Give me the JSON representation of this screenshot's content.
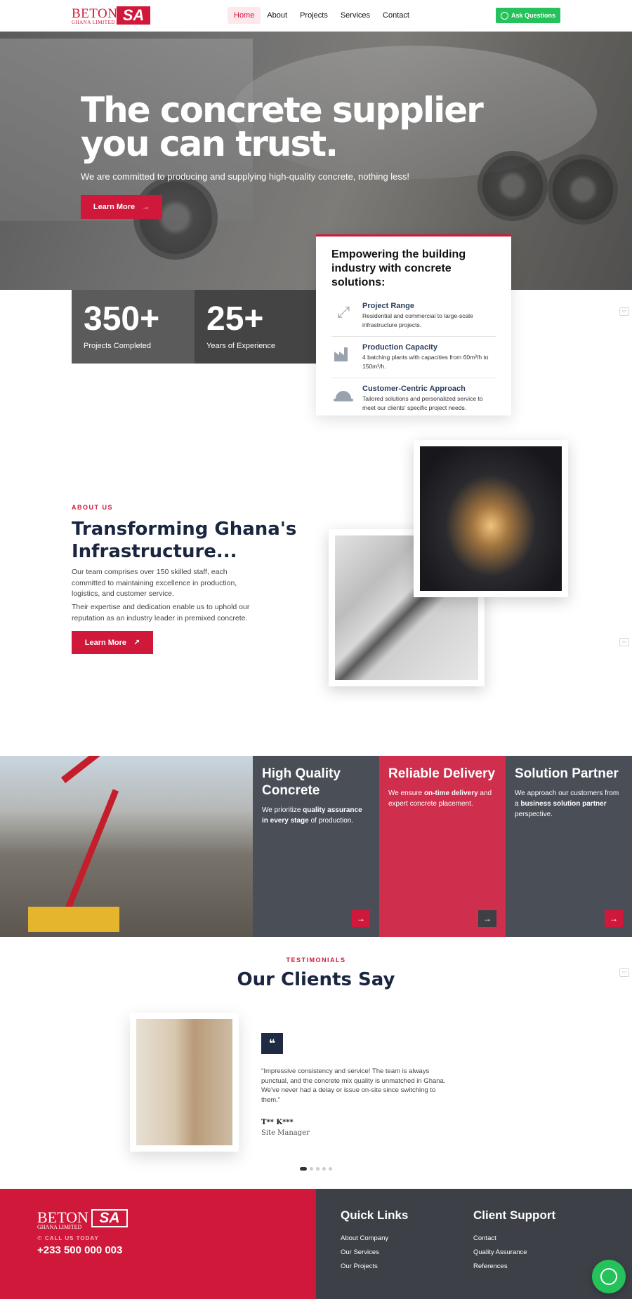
{
  "nav": {
    "logo_text": "BETON",
    "logo_sub": "GHANA LIMITED",
    "logo_mark": "SA",
    "items": [
      "Home",
      "About",
      "Projects",
      "Services",
      "Contact"
    ],
    "cta": "Ask Questions"
  },
  "hero": {
    "title": "The concrete supplier you can trust.",
    "subtitle": "We are committed to producing and supplying high-quality concrete, nothing less!",
    "button": "Learn More"
  },
  "stats": [
    {
      "value": "350+",
      "label": "Projects Completed"
    },
    {
      "value": "25+",
      "label": "Years of Experience"
    }
  ],
  "feature_card": {
    "title": "Empowering the building industry with concrete solutions:",
    "items": [
      {
        "icon": "expand-arrows-icon",
        "title": "Project Range",
        "desc": "Residential and commercial to large-scale infrastructure projects."
      },
      {
        "icon": "factory-icon",
        "title": "Production Capacity",
        "desc": "4 batching plants with capacities from 60m³/h to 150m³/h."
      },
      {
        "icon": "hardhat-icon",
        "title": "Customer-Centric Approach",
        "desc": "Tailored solutions and personalized service to meet our clients' specific project needs."
      }
    ]
  },
  "about": {
    "tag": "ABOUT US",
    "title": "Transforming Ghana's Infrastructure...",
    "p1": "Our team comprises over 150 skilled staff, each committed to maintaining excellence in production, logistics, and customer service.",
    "p2": "Their expertise and dedication enable us to uphold our reputation as an industry leader in premixed concrete.",
    "button": "Learn More"
  },
  "services": [
    {
      "title": "High Quality Concrete",
      "text_pre": "We prioritize ",
      "text_bold": "quality assurance in every stage",
      "text_post": " of production."
    },
    {
      "title": "Reliable Delivery",
      "text_pre": "We ensure ",
      "text_bold": "on-time delivery",
      "text_post": " and expert concrete placement."
    },
    {
      "title": "Solution Partner",
      "text_pre": "We approach our customers from a ",
      "text_bold": "business solution partner",
      "text_post": " perspective."
    }
  ],
  "testimonials": {
    "tag": "TESTIMONIALS",
    "title": "Our Clients Say",
    "quote": "\"Impressive consistency and service! The team is always punctual, and the concrete mix quality is unmatched in Ghana. We've never had a delay or issue on-site since switching to them.\"",
    "name": "T** K***",
    "role": "Site Manager",
    "slides": 5,
    "active_slide": 1
  },
  "footer": {
    "logo_text": "BETON",
    "logo_sub": "GHANA LIMITED",
    "logo_mark": "SA",
    "call_label": "CALL US TODAY",
    "phone": "+233 500 000 003",
    "quick_links_title": "Quick Links",
    "quick_links": [
      "About Company",
      "Our Services",
      "Our Projects"
    ],
    "support_title": "Client Support",
    "support_links": [
      "Contact",
      "Quality Assurance",
      "References"
    ]
  },
  "colors": {
    "brand_red": "#d0183a",
    "whatsapp_green": "#25c15a",
    "navy": "#1a2540",
    "slate": "#4a4e57"
  }
}
